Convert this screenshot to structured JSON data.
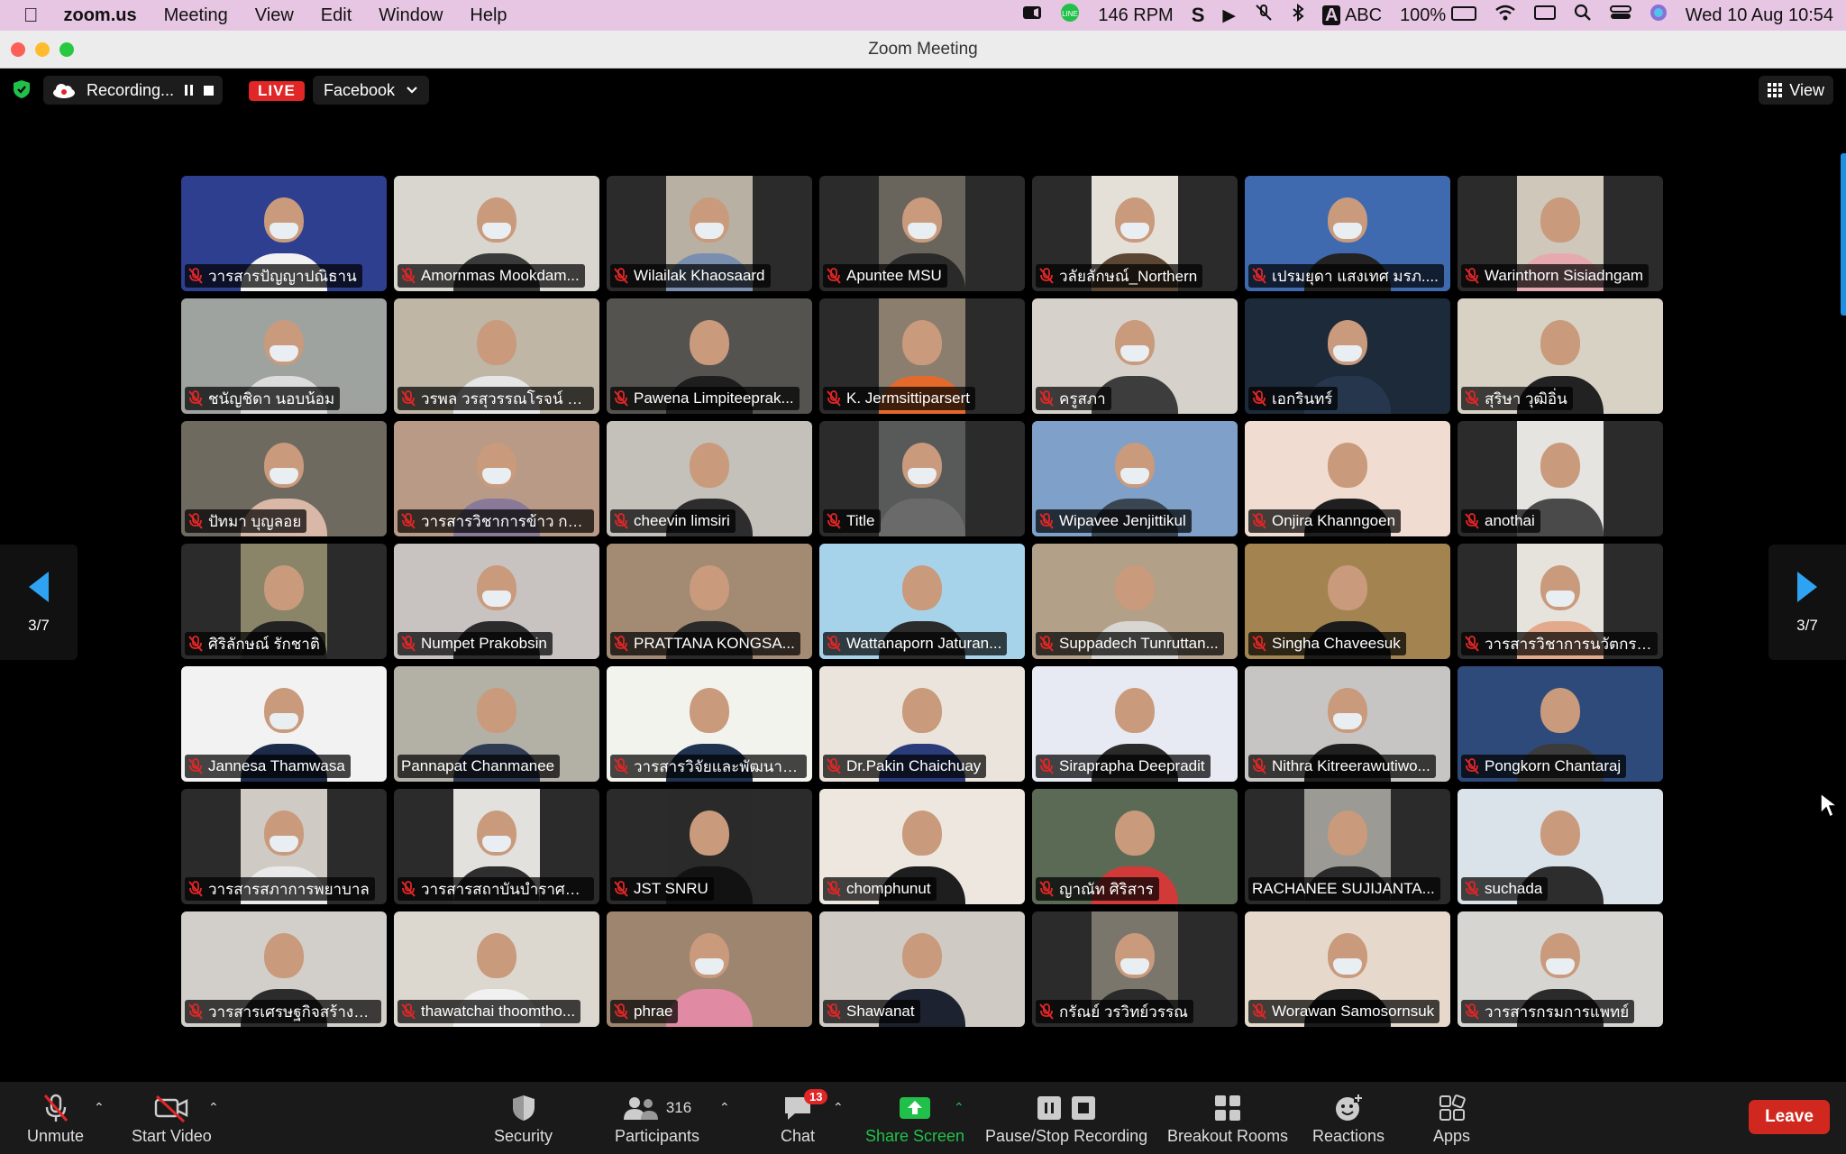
{
  "menubar": {
    "app_name": "zoom.us",
    "items": [
      "Meeting",
      "View",
      "Edit",
      "Window",
      "Help"
    ],
    "rpm_value": "146",
    "rpm_unit": "RPM",
    "input_source": "ABC",
    "battery": "100%",
    "datetime": "Wed 10 Aug  10:54"
  },
  "window": {
    "title": "Zoom Meeting"
  },
  "status": {
    "recording_label": "Recording...",
    "live_label": "LIVE",
    "stream_target": "Facebook",
    "view_label": "View"
  },
  "pagination": {
    "left": "3/7",
    "right": "3/7"
  },
  "participants": [
    {
      "name": "วารสารปัญญาปณิธาน",
      "bg": "#2e3f8f",
      "shirt": "#f2f2f2"
    },
    {
      "name": "Amornmas Mookdam...",
      "bg": "#d9d6d0",
      "shirt": "#3a3a3a"
    },
    {
      "name": "Wilailak Khaosaard",
      "bg": "#b8b0a2",
      "shirt": "#7a8fb0"
    },
    {
      "name": "Apuntee MSU",
      "bg": "#6a655c",
      "shirt": "#2a2a2a"
    },
    {
      "name": "วลัยลักษณ์_Northern",
      "bg": "#e4e0d8",
      "shirt": "#5a4632"
    },
    {
      "name": "เปรมยุดา แสงเทศ มรภ....",
      "bg": "#3f6ab0",
      "shirt": "#222"
    },
    {
      "name": "Warinthorn Sisiadngam",
      "bg": "#cfc7b9",
      "shirt": "#e7a9b0"
    },
    {
      "name": "ชนัญชิดา  นอบน้อม",
      "bg": "#9ea3a0",
      "shirt": "#dcdcdc"
    },
    {
      "name": "วรพล วรสุวรรณโรจน์ วส...",
      "bg": "#bfb6a6",
      "shirt": "#e6e6e6"
    },
    {
      "name": "Pawena Limpiteeprak...",
      "bg": "#55534f",
      "shirt": "#1e1e1e"
    },
    {
      "name": "K. Jermsittiparsert",
      "bg": "#8c7e6f",
      "shirt": "#e36a2a"
    },
    {
      "name": "ครูสภา",
      "bg": "#d6d2cb",
      "shirt": "#3d3d3d"
    },
    {
      "name": "เอกรินทร์",
      "bg": "#1d2a3a",
      "shirt": "#26374d"
    },
    {
      "name": "สุริษา วุฒิอิ่น",
      "bg": "#d8d2c5",
      "shirt": "#222"
    },
    {
      "name": "ปัทมา บุญลอย",
      "bg": "#6e6a60",
      "shirt": "#d9b8a8"
    },
    {
      "name": "วารสารวิชาการข้าว กรม...",
      "bg": "#b99a86",
      "shirt": "#8a7a9a"
    },
    {
      "name": "cheevin limsiri",
      "bg": "#c4c1ba",
      "shirt": "#2d2d2d"
    },
    {
      "name": "Title",
      "bg": "#585a59",
      "shirt": "#6a6a6a"
    },
    {
      "name": "Wipavee Jenjittikul",
      "bg": "#7fa0c9",
      "shirt": "#3a4552"
    },
    {
      "name": "Onjira Khanngoen",
      "bg": "#f0dcd0",
      "shirt": "#1f1f1f"
    },
    {
      "name": "anothai",
      "bg": "#e6e4e0",
      "shirt": "#4a4a4a"
    },
    {
      "name": "ศิริลักษณ์ รักชาติ",
      "bg": "#8a8568",
      "shirt": "#222"
    },
    {
      "name": "Numpet Prakobsin",
      "bg": "#c8c3c1",
      "shirt": "#2b2b2b"
    },
    {
      "name": "PRATTANA KONGSA...",
      "bg": "#a28a73",
      "shirt": "#2a2a2a"
    },
    {
      "name": "Wattanaporn Jaturan...",
      "bg": "#a7d3ea",
      "shirt": "#2b2b2b"
    },
    {
      "name": "Suppadech Tunruttan...",
      "bg": "#b2a089",
      "shirt": "#d8d6d2"
    },
    {
      "name": "Singha Chaveesuk",
      "bg": "#a38450",
      "shirt": "#1b1b1b"
    },
    {
      "name": "วารสารวิชาการนวัตกรร...",
      "bg": "#e6e2dc",
      "shirt": "#e3a98c"
    },
    {
      "name": "Jannesa Thamwasa",
      "bg": "#f2f2f2",
      "shirt": "#1c2b4a"
    },
    {
      "name": "Pannapat Chanmanee",
      "bg": "#b3b0a6",
      "shirt": "#2f3b52"
    },
    {
      "name": "วารสารวิจัยและพัฒนา ว...",
      "bg": "#f3f3ee",
      "shirt": "#1f3350"
    },
    {
      "name": "Dr.Pakin Chaichuay",
      "bg": "#ebe4dc",
      "shirt": "#2a3d7a"
    },
    {
      "name": "Siraprapha Deepradit",
      "bg": "#e7eaf2",
      "shirt": "#2a2a2a"
    },
    {
      "name": "Nithra Kitreerawutiwo...",
      "bg": "#c7c5c3",
      "shirt": "#1f1f1f"
    },
    {
      "name": "Pongkorn Chantaraj",
      "bg": "#2e4a7a",
      "shirt": "#3b3b3b"
    },
    {
      "name": "วารสารสภาการพยาบาล",
      "bg": "#cfcac3",
      "shirt": "#e9e9e9"
    },
    {
      "name": "วารสารสถาบันบำราศนร...",
      "bg": "#e3e1dd",
      "shirt": "#2e2e2e"
    },
    {
      "name": "JST SNRU",
      "bg": "#2a2a2a",
      "shirt": "#121212"
    },
    {
      "name": "chomphunut",
      "bg": "#ede7df",
      "shirt": "#1e1e1e"
    },
    {
      "name": "ญาณัท ศิริสาร",
      "bg": "#5b6a55",
      "shirt": "#d23a3a"
    },
    {
      "name": "RACHANEE SUJIJANTA...",
      "bg": "#9c9a94",
      "shirt": "#2a2a2a"
    },
    {
      "name": "suchada",
      "bg": "#dbe3ea",
      "shirt": "#2d2d2d"
    },
    {
      "name": "วารสารเศรษฐกิจสร้างสร...",
      "bg": "#d2cfca",
      "shirt": "#2c2c2c"
    },
    {
      "name": "thawatchai thoomtho...",
      "bg": "#ddd8cf",
      "shirt": "#f1f1f1"
    },
    {
      "name": "phrae",
      "bg": "#9e8570",
      "shirt": "#e08aa3"
    },
    {
      "name": "Shawanat",
      "bg": "#cfcbc4",
      "shirt": "#1d2230"
    },
    {
      "name": "กรัณย์ วรวิทย์วรรณ",
      "bg": "#7a766c",
      "shirt": "#2a2a2a"
    },
    {
      "name": "Worawan Samosornsuk",
      "bg": "#e6d9cc",
      "shirt": "#1b1b1b"
    },
    {
      "name": "วารสารกรมการแพทย์",
      "bg": "#d7d5d2",
      "shirt": "#2b2b2b"
    }
  ],
  "toolbar": {
    "unmute": "Unmute",
    "start_video": "Start Video",
    "security": "Security",
    "participants": "Participants",
    "participants_count": "316",
    "chat": "Chat",
    "chat_badge": "13",
    "share_screen": "Share Screen",
    "pause_stop_recording": "Pause/Stop Recording",
    "breakout_rooms": "Breakout Rooms",
    "reactions": "Reactions",
    "apps": "Apps",
    "leave": "Leave"
  },
  "colors": {
    "accent": "#3da9f5",
    "share_green": "#21c04b",
    "leave_red": "#d0281f",
    "live_red": "#e02626"
  }
}
